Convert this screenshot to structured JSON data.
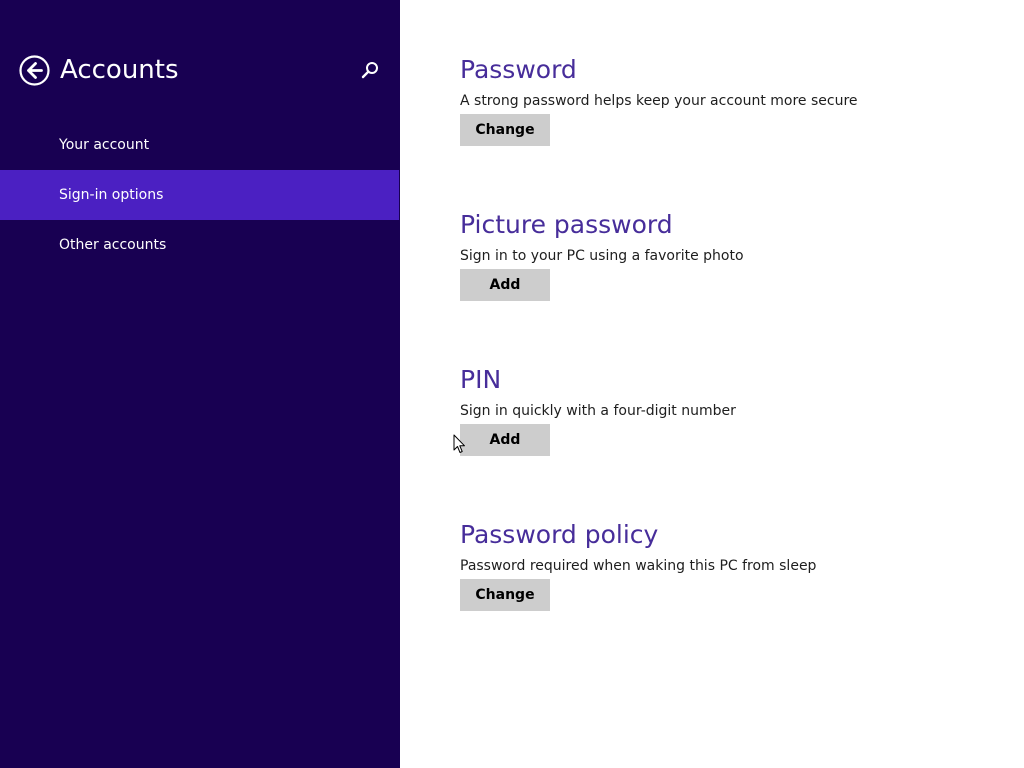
{
  "sidebar": {
    "title": "Accounts",
    "back_icon": "back-arrow-circle-icon",
    "search_icon": "search-icon",
    "items": [
      {
        "label": "Your account",
        "selected": false
      },
      {
        "label": "Sign-in options",
        "selected": true
      },
      {
        "label": "Other accounts",
        "selected": false
      }
    ]
  },
  "content": {
    "sections": [
      {
        "title": "Password",
        "description": "A strong password helps keep your account more secure",
        "button_label": "Change"
      },
      {
        "title": "Picture password",
        "description": "Sign in to your PC using a favorite photo",
        "button_label": "Add"
      },
      {
        "title": "PIN",
        "description": "Sign in quickly with a four-digit number",
        "button_label": "Add"
      },
      {
        "title": "Password policy",
        "description": "Password required when waking this PC from sleep",
        "button_label": "Change"
      }
    ]
  },
  "colors": {
    "sidebar_bg": "#180052",
    "selected_item_bg": "#4b20c2",
    "heading": "#472d9a",
    "button_bg": "#cdcdcd"
  }
}
